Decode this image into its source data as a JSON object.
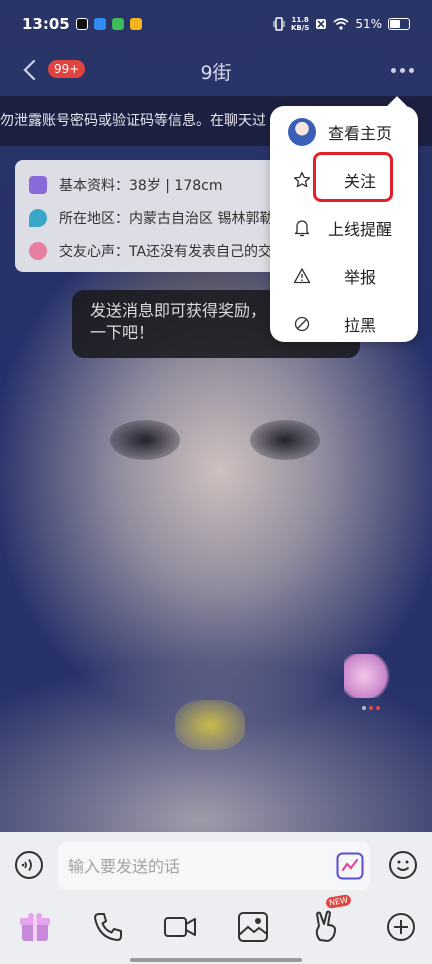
{
  "status_bar": {
    "time": "13:05",
    "net_speed_value": "11.8",
    "net_speed_unit": "KB/S",
    "battery": "51%"
  },
  "header": {
    "unread_badge": "99+",
    "title": "9街"
  },
  "banner": {
    "text": "勿泄露账号密码或验证码等信息。在聊天过"
  },
  "profile_card": {
    "rows": [
      {
        "label": "基本资料：38岁 | 178cm",
        "icon": "id-card-icon",
        "color": "#8a6ad8"
      },
      {
        "label": "所在地区：内蒙古自治区 锡林郭勒",
        "icon": "location-pin-icon",
        "color": "#3aa7c9"
      },
      {
        "label": "交友心声：TA还没有发表自己的交",
        "icon": "heart-icon",
        "color": "#e77fa1"
      }
    ]
  },
  "hint": {
    "line1": "发送消息即可获得奖励，",
    "line2": "一下吧！"
  },
  "menu": {
    "items": [
      {
        "label": "查看主页",
        "icon": "avatar-icon"
      },
      {
        "label": "关注",
        "icon": "star-icon"
      },
      {
        "label": "上线提醒",
        "icon": "bell-icon"
      },
      {
        "label": "举报",
        "icon": "warning-icon"
      },
      {
        "label": "拉黑",
        "icon": "block-icon"
      }
    ],
    "highlighted_item": "关注",
    "highlight_color": "#e3202a"
  },
  "input": {
    "placeholder": "输入要发送的话"
  },
  "toolbar": {
    "new_badge": "NEW",
    "items": [
      "gift-icon",
      "phone-icon",
      "video-icon",
      "photo-icon",
      "victory-hand-icon",
      "plus-icon"
    ]
  }
}
